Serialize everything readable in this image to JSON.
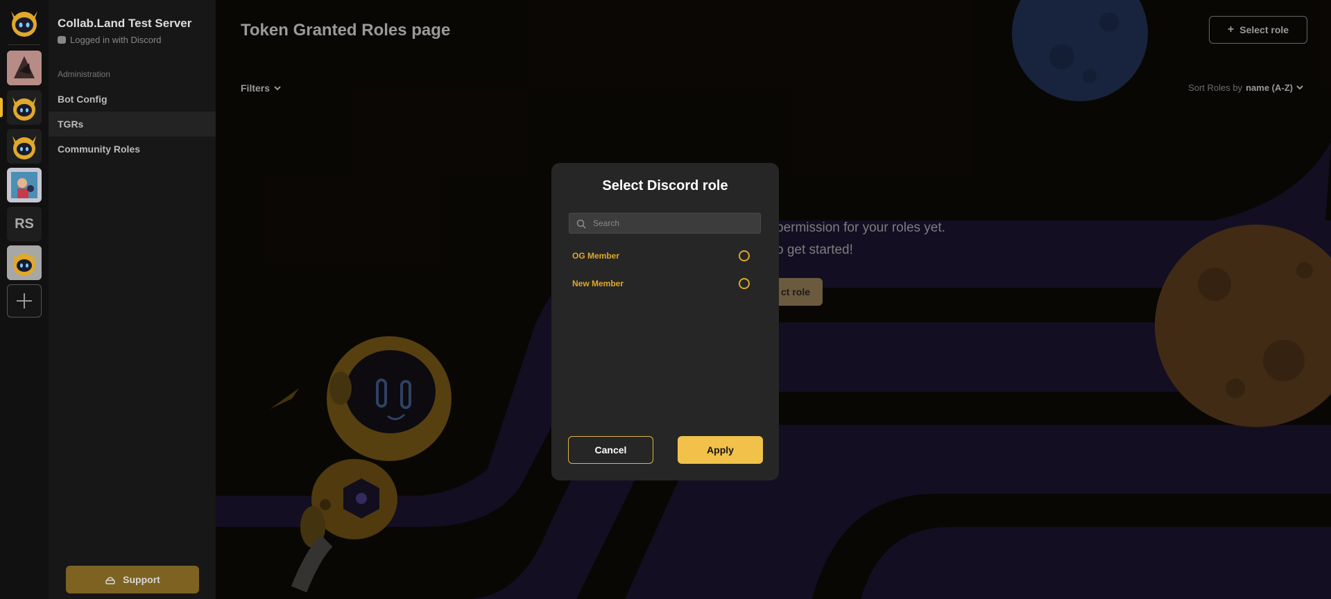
{
  "rail": {
    "servers": [
      {
        "name": "server-avatar-1",
        "type": "image"
      },
      {
        "name": "collab-land-bot",
        "type": "image"
      },
      {
        "name": "collab-land-bot-2",
        "type": "image"
      },
      {
        "name": "server-avatar-4",
        "type": "image"
      },
      {
        "name": "server-initials",
        "type": "text"
      },
      {
        "name": "collab-land-bot-3",
        "type": "image"
      }
    ],
    "initials": "RS",
    "active_color": "#f0b830"
  },
  "sidebar": {
    "server_name": "Collab.Land Test Server",
    "login_status": "Logged in with Discord",
    "section_label": "Administration",
    "items": [
      {
        "label": "Bot Config",
        "active": false
      },
      {
        "label": "TGRs",
        "active": true
      },
      {
        "label": "Community Roles",
        "active": false
      }
    ],
    "support_label": "Support"
  },
  "header": {
    "title": "Token Granted Roles page",
    "select_role_label": "Select role"
  },
  "toolbar": {
    "filters_label": "Filters",
    "sort_prefix": "Sort Roles by",
    "sort_value": "name (A-Z)"
  },
  "empty_state": {
    "line1": "permission for your roles yet.",
    "line2": "o get started!",
    "button_label": "ct role"
  },
  "modal": {
    "title": "Select Discord role",
    "search_placeholder": "Search",
    "roles": [
      {
        "label": "OG Member",
        "selected": false
      },
      {
        "label": "New Member",
        "selected": false
      }
    ],
    "cancel_label": "Cancel",
    "apply_label": "Apply"
  },
  "colors": {
    "accent": "#f2c14a",
    "role_text": "#e0a92b",
    "modal_bg": "#262626",
    "track_purple": "#231a48"
  }
}
